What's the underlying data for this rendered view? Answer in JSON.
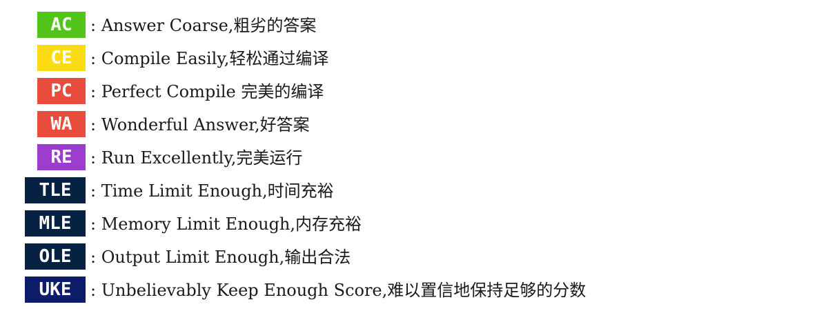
{
  "items": [
    {
      "code": "AC",
      "desc": ": Answer Coarse,粗劣的答案",
      "color": "#52c41a"
    },
    {
      "code": "CE",
      "desc": ": Compile Easily,轻松通过编译",
      "color": "#fadb14"
    },
    {
      "code": "PC",
      "desc": ": Perfect Compile 完美的编译",
      "color": "#e74c3c"
    },
    {
      "code": "WA",
      "desc": ": Wonderful Answer,好答案",
      "color": "#e74c3c"
    },
    {
      "code": "RE",
      "desc": ": Run Excellently,完美运行",
      "color": "#9d3dcf"
    },
    {
      "code": "TLE",
      "desc": ": Time Limit Enough,时间充裕",
      "color": "#052242"
    },
    {
      "code": "MLE",
      "desc": ": Memory Limit Enough,内存充裕",
      "color": "#052242"
    },
    {
      "code": "OLE",
      "desc": ": Output Limit Enough,输出合法",
      "color": "#052242"
    },
    {
      "code": "UKE",
      "desc": ": Unbelievably Keep Enough Score,难以置信地保持足够的分数",
      "color": "#0e1d69"
    }
  ]
}
